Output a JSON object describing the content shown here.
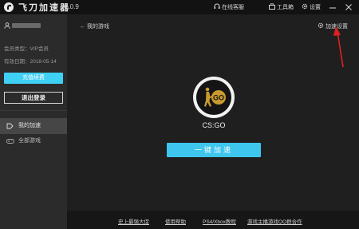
{
  "titlebar": {
    "app_name": "飞刀加速器",
    "version": "v2.0.9",
    "support": "在线客服",
    "toolbox": "工具箱",
    "settings": "设置"
  },
  "sidebar": {
    "member_type_label": "会员类型：",
    "member_type": "VIP会员",
    "expiry_label": "有效日期：",
    "expiry": "2018-05-14",
    "recharge": "充值续费",
    "logout": "退出登录",
    "nav": [
      {
        "label": "我的加速",
        "icon": "bookmark-icon",
        "active": true
      },
      {
        "label": "全部游戏",
        "icon": "gamepad-icon",
        "active": false
      }
    ]
  },
  "main": {
    "back_label": "我的游戏",
    "settings_label": "加速设置",
    "game": {
      "badge": "GO",
      "name": "CS:GO"
    },
    "accelerate": "一键加速"
  },
  "footer": {
    "links": [
      "史上最强大促",
      "使用帮助",
      "PS4/Xbox教程",
      "游戏主播游戏QQ群合作"
    ]
  },
  "colors": {
    "accent": "#3ec6ef",
    "annotation_arrow": "#e02020",
    "badge_gold": "#c99a2e"
  }
}
